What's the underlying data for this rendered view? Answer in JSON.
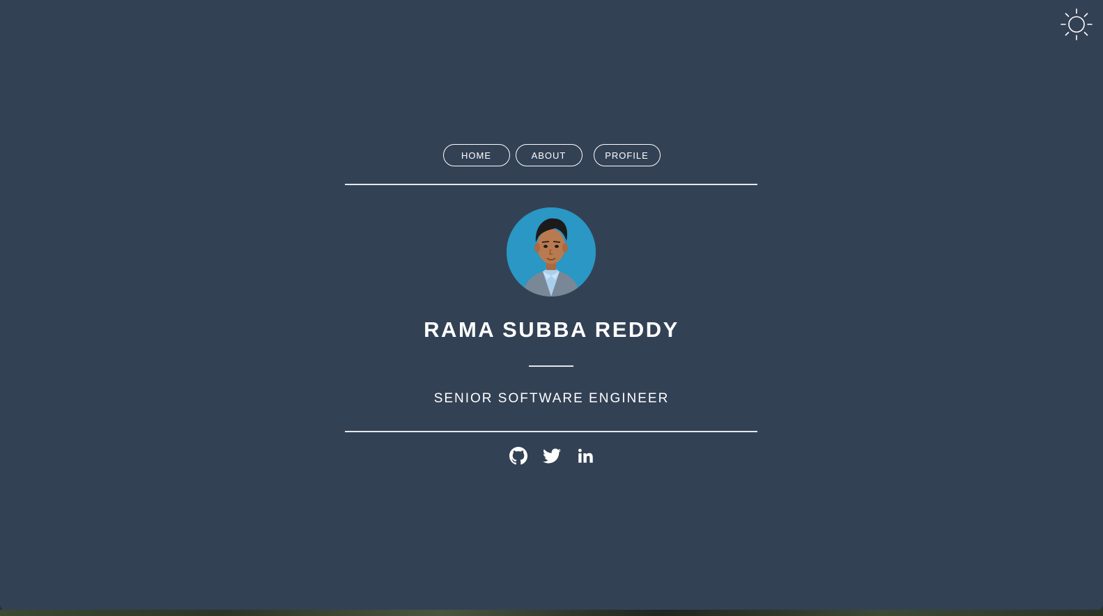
{
  "nav": {
    "items": [
      {
        "label": "HOME"
      },
      {
        "label": "ABOUT"
      },
      {
        "label": "PROFILE"
      }
    ]
  },
  "profile": {
    "name": "RAMA SUBBA REDDY",
    "title": "SENIOR SOFTWARE ENGINEER",
    "avatar_bg": "#2a97c4"
  },
  "socials": [
    {
      "icon": "github-icon"
    },
    {
      "icon": "twitter-icon"
    },
    {
      "icon": "linkedin-icon"
    }
  ],
  "theme": {
    "background": "#334155",
    "toggle_icon": "sun-icon"
  }
}
